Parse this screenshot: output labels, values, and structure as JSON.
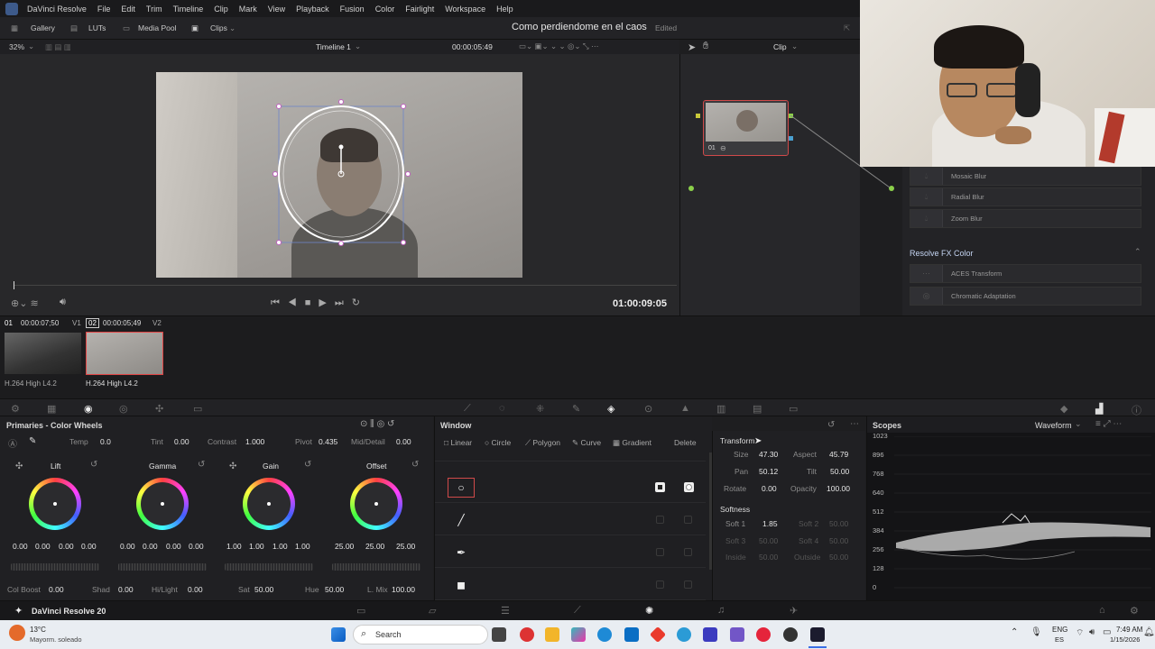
{
  "menubar": {
    "app_icon": "davinci-icon",
    "items": [
      "DaVinci Resolve",
      "File",
      "Edit",
      "Trim",
      "Timeline",
      "Clip",
      "Mark",
      "View",
      "Playback",
      "Fusion",
      "Color",
      "Fairlight",
      "Workspace",
      "Help"
    ]
  },
  "toolbar": {
    "gallery": "Gallery",
    "luts": "LUTs",
    "media_pool": "Media Pool",
    "clips": "Clips",
    "project_title": "Como perdiendome en el caos",
    "edited": "Edited"
  },
  "viewer": {
    "zoom": "32%",
    "timeline_name": "Timeline 1",
    "timecode_top": "00:00:05:49",
    "timecode_main": "01:00:09:05",
    "node_mode": "Clip"
  },
  "node": {
    "label": "01"
  },
  "fx": {
    "items_top": [
      "Mosaic Blur",
      "Radial Blur",
      "Zoom Blur"
    ],
    "section": "Resolve FX Color",
    "items_bottom": [
      "ACES Transform",
      "Chromatic Adaptation"
    ]
  },
  "clips": [
    {
      "num": "01",
      "tc": "00:00:07;50",
      "track": "V1",
      "codec": "H.264 High L4.2"
    },
    {
      "num": "02",
      "tc": "00:00:05;49",
      "track": "V2",
      "codec": "H.264 High L4.2"
    }
  ],
  "primaries": {
    "title": "Primaries - Color Wheels",
    "temp_label": "Temp",
    "temp": "0.0",
    "tint_label": "Tint",
    "tint": "0.00",
    "contrast_label": "Contrast",
    "contrast": "1.000",
    "pivot_label": "Pivot",
    "pivot": "0.435",
    "middetail_label": "Mid/Detail",
    "middetail": "0.00",
    "wheels": [
      {
        "name": "Lift",
        "vals": [
          "0.00",
          "0.00",
          "0.00",
          "0.00"
        ]
      },
      {
        "name": "Gamma",
        "vals": [
          "0.00",
          "0.00",
          "0.00",
          "0.00"
        ]
      },
      {
        "name": "Gain",
        "vals": [
          "1.00",
          "1.00",
          "1.00",
          "1.00"
        ]
      },
      {
        "name": "Offset",
        "vals": [
          "25.00",
          "25.00",
          "25.00"
        ]
      }
    ],
    "colboost_label": "Col Boost",
    "colboost": "0.00",
    "shad_label": "Shad",
    "shad": "0.00",
    "hilight_label": "Hi/Light",
    "hilight": "0.00",
    "sat_label": "Sat",
    "sat": "50.00",
    "hue_label": "Hue",
    "hue": "50.00",
    "lmix_label": "L. Mix",
    "lmix": "100.00"
  },
  "window": {
    "title": "Window",
    "tools": [
      "Linear",
      "Circle",
      "Polygon",
      "Curve",
      "Gradient"
    ],
    "delete": "Delete"
  },
  "transform": {
    "title": "Transform",
    "size_label": "Size",
    "size": "47.30",
    "aspect_label": "Aspect",
    "aspect": "45.79",
    "pan_label": "Pan",
    "pan": "50.12",
    "tilt_label": "Tilt",
    "tilt": "50.00",
    "rotate_label": "Rotate",
    "rotate": "0.00",
    "opacity_label": "Opacity",
    "opacity": "100.00",
    "softness_title": "Softness",
    "soft1_label": "Soft 1",
    "soft1": "1.85",
    "soft2_label": "Soft 2",
    "soft2": "50.00",
    "soft3_label": "Soft 3",
    "soft3": "50.00",
    "soft4_label": "Soft 4",
    "soft4": "50.00",
    "inside_label": "Inside",
    "inside": "50.00",
    "outside_label": "Outside",
    "outside": "50.00"
  },
  "scopes": {
    "title": "Scopes",
    "mode": "Waveform",
    "ticks": [
      "1023",
      "896",
      "768",
      "640",
      "512",
      "384",
      "256",
      "128",
      "0"
    ]
  },
  "bottom": {
    "app": "DaVinci Resolve 20"
  },
  "taskbar": {
    "temp": "13°C",
    "weather": "Mayorm. soleado",
    "search": "Search",
    "lang1": "ENG",
    "lang2": "ES",
    "time": "7:49 AM",
    "date": "1/15/2026"
  }
}
